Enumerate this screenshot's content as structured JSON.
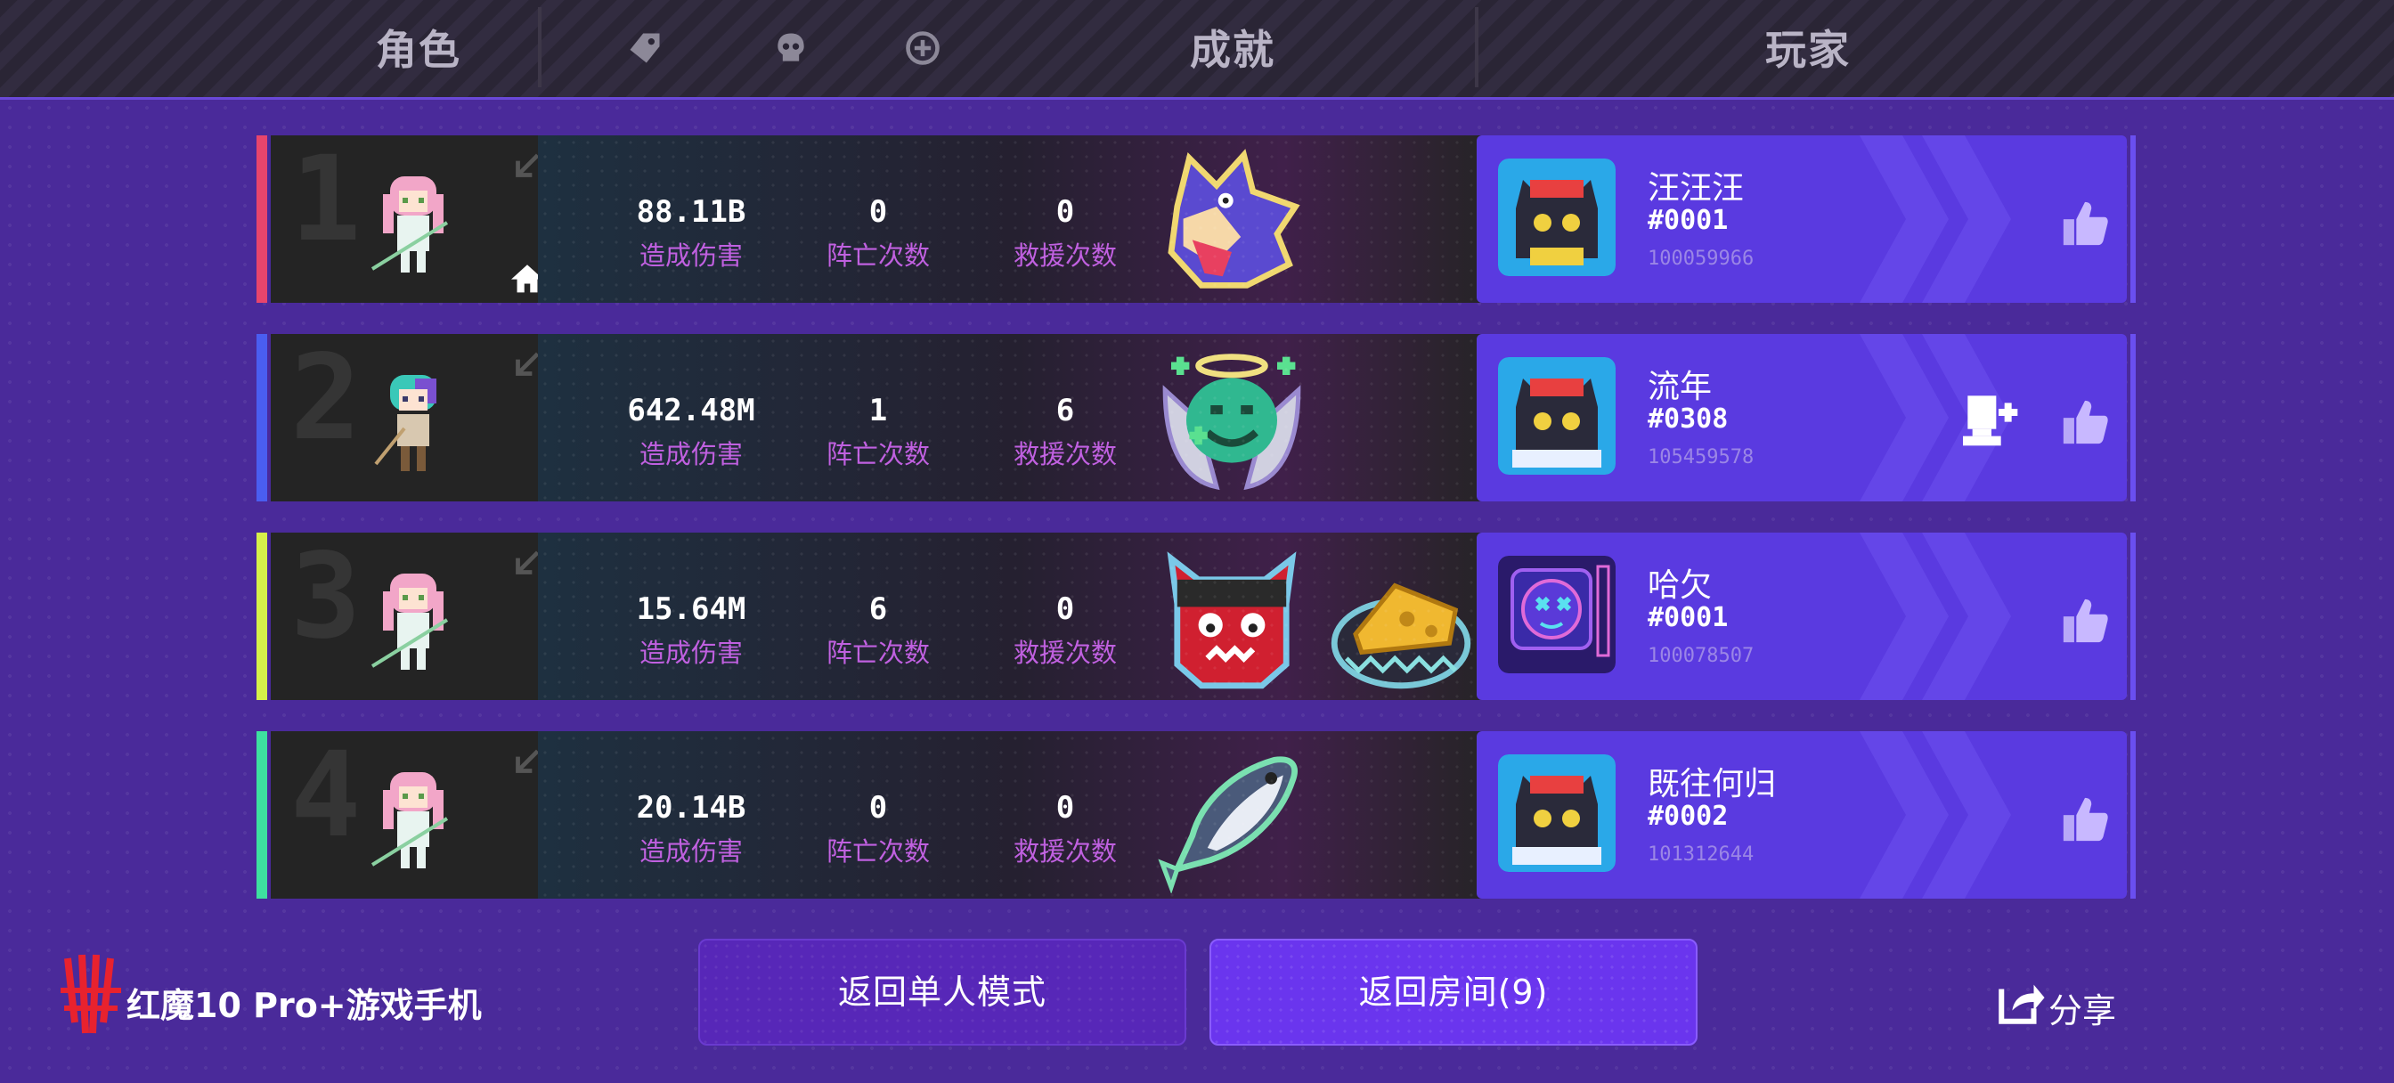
{
  "header": {
    "col_character": "角色",
    "col_achievement": "成就",
    "col_player": "玩家",
    "filter_icons": [
      "tag-icon",
      "skull-icon",
      "target-icon"
    ]
  },
  "rows": [
    {
      "rank": "1",
      "accent_color": "#e8456c",
      "is_host": true,
      "damage": "88.11B",
      "damage_label": "造成伤害",
      "deaths": "0",
      "deaths_label": "阵亡次数",
      "rescues": "0",
      "rescues_label": "救援次数",
      "achievements": [
        "wolf-badge"
      ],
      "player_name": "汪汪汪",
      "player_tag": "#0001",
      "player_id": "100059966"
    },
    {
      "rank": "2",
      "accent_color": "#4a5ef0",
      "is_host": false,
      "damage": "642.48M",
      "damage_label": "造成伤害",
      "deaths": "1",
      "deaths_label": "阵亡次数",
      "rescues": "6",
      "rescues_label": "救援次数",
      "achievements": [
        "angel-blob-badge"
      ],
      "player_name": "流年",
      "player_tag": "#0308",
      "player_id": "105459578"
    },
    {
      "rank": "3",
      "accent_color": "#d6f04a",
      "is_host": false,
      "damage": "15.64M",
      "damage_label": "造成伤害",
      "deaths": "6",
      "deaths_label": "阵亡次数",
      "rescues": "0",
      "rescues_label": "救援次数",
      "achievements": [
        "oni-badge",
        "cheese-trap-badge"
      ],
      "player_name": "哈欠",
      "player_tag": "#0001",
      "player_id": "100078507"
    },
    {
      "rank": "4",
      "accent_color": "#3ee0a0",
      "is_host": false,
      "damage": "20.14B",
      "damage_label": "造成伤害",
      "deaths": "0",
      "deaths_label": "阵亡次数",
      "rescues": "0",
      "rescues_label": "救援次数",
      "achievements": [
        "fish-badge"
      ],
      "player_name": "既往何归",
      "player_tag": "#0002",
      "player_id": "101312644"
    }
  ],
  "footer": {
    "brand_text": "红魔10 Pro+游戏手机",
    "btn_solo": "返回单人模式",
    "btn_room": "返回房间(9)",
    "share": "分享"
  }
}
